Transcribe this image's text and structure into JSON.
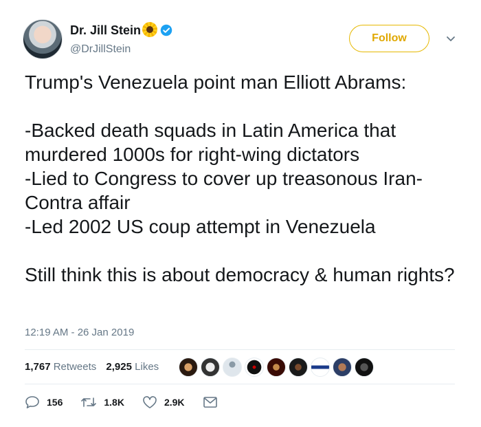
{
  "author": {
    "name": "Dr. Jill Stein",
    "handle": "@DrJillStein",
    "emoji": "sunflower",
    "verified": true
  },
  "follow_label": "Follow",
  "tweet_text": "Trump's Venezuela point man Elliott Abrams:\n\n-Backed death squads in Latin America that murdered 1000s for right-wing dictators\n-Lied to Congress to cover up treasonous Iran-Contra affair\n-Led 2002 US coup attempt in Venezuela\n\nStill think this is about democracy & human rights?",
  "timestamp": "12:19 AM - 26 Jan 2019",
  "stats": {
    "retweets_count": "1,767",
    "retweets_label": "Retweets",
    "likes_count": "2,925",
    "likes_label": "Likes"
  },
  "actions": {
    "replies": "156",
    "retweets": "1.8K",
    "likes": "2.9K"
  },
  "colors": {
    "follow_accent": "#e0a800",
    "meta_gray": "#657786",
    "verified_blue": "#1da1f2"
  }
}
